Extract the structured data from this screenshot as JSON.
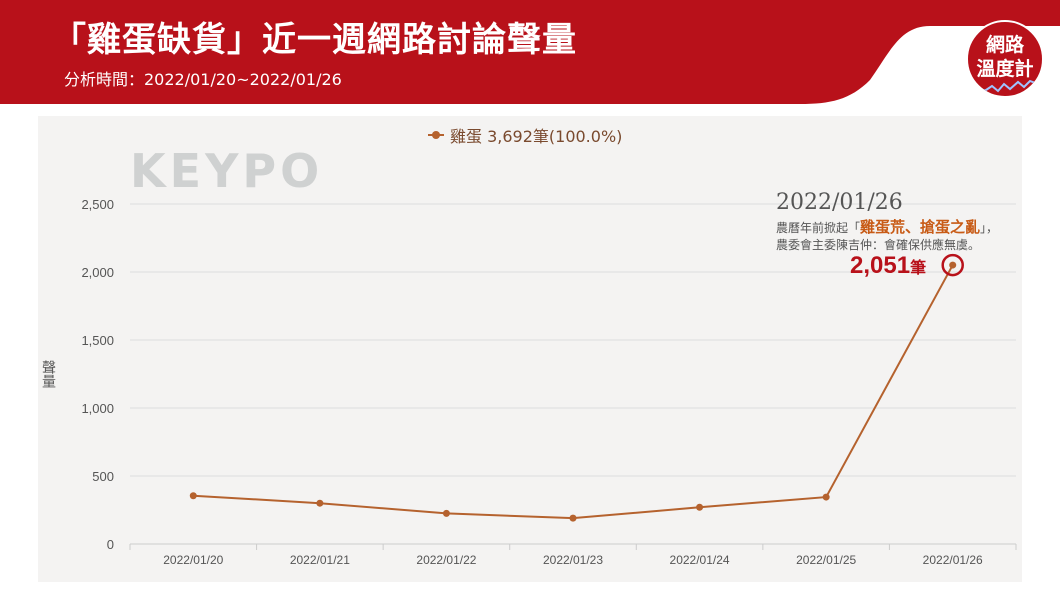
{
  "header": {
    "title": "「雞蛋缺貨」近一週網路討論聲量",
    "subtitle": "分析時間：2022/01/20~2022/01/26"
  },
  "badge": {
    "line1": "網路",
    "line2": "溫度計"
  },
  "watermark": "KEYPO",
  "colors": {
    "header": "#b8111a",
    "series": "#b5622e",
    "highlight": "#c85b16"
  },
  "legend": {
    "label": "雞蛋 3,692筆(100.0%)"
  },
  "annotation": {
    "date": "2022/01/26",
    "line1_prefix": "農曆年前掀起「",
    "line1_highlight": "雞蛋荒、搶蛋之亂",
    "line1_suffix": "」，",
    "line2": "農委會主委陳吉仲：會確保供應無虞。",
    "value": "2,051",
    "unit": "筆"
  },
  "chart_data": {
    "type": "line",
    "categories": [
      "2022/01/20",
      "2022/01/21",
      "2022/01/22",
      "2022/01/23",
      "2022/01/24",
      "2022/01/25",
      "2022/01/26"
    ],
    "series": [
      {
        "name": "雞蛋",
        "values": [
          355,
          300,
          225,
          190,
          270,
          345,
          2051
        ]
      }
    ],
    "ylabel": "聲量",
    "ylim": [
      0,
      2500
    ],
    "yticks": [
      0,
      500,
      1000,
      1500,
      2000,
      2500
    ],
    "ytick_labels": [
      "0",
      "500",
      "1,000",
      "1,500",
      "2,000",
      "2,500"
    ],
    "grid": true
  }
}
